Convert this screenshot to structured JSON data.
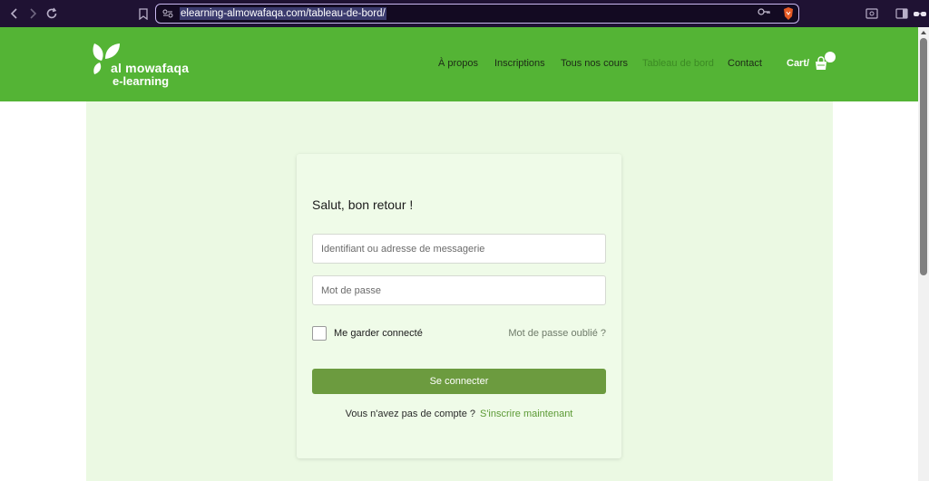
{
  "browser": {
    "url": "elearning-almowafaqa.com/tableau-de-bord/"
  },
  "header": {
    "logo_line1": "al mowafaqa",
    "logo_line2": "e-learning",
    "nav": [
      {
        "label": "À propos"
      },
      {
        "label": "Inscriptions"
      },
      {
        "label": "Tous nos cours"
      },
      {
        "label": "Tableau de bord"
      },
      {
        "label": "Contact"
      }
    ],
    "cart_label": "Cart/"
  },
  "login": {
    "title": "Salut, bon retour !",
    "username_placeholder": "Identifiant ou adresse de messagerie",
    "password_placeholder": "Mot de passe",
    "remember_label": "Me garder connecté",
    "forgot_label": "Mot de passe oublié ?",
    "submit_label": "Se connecter",
    "no_account_text": "Vous n'avez pas de compte ?",
    "register_link": "S'inscrire maintenant"
  },
  "colors": {
    "header_green": "#54b435",
    "button_green": "#6c9b3f",
    "link_green": "#5c9a35",
    "chrome_purple": "#1f1233"
  },
  "icons": [
    "back-icon",
    "forward-icon",
    "reload-icon",
    "bookmark-icon",
    "site-settings-icon",
    "password-key-icon",
    "brave-shield-icon",
    "cart-bag-icon"
  ]
}
